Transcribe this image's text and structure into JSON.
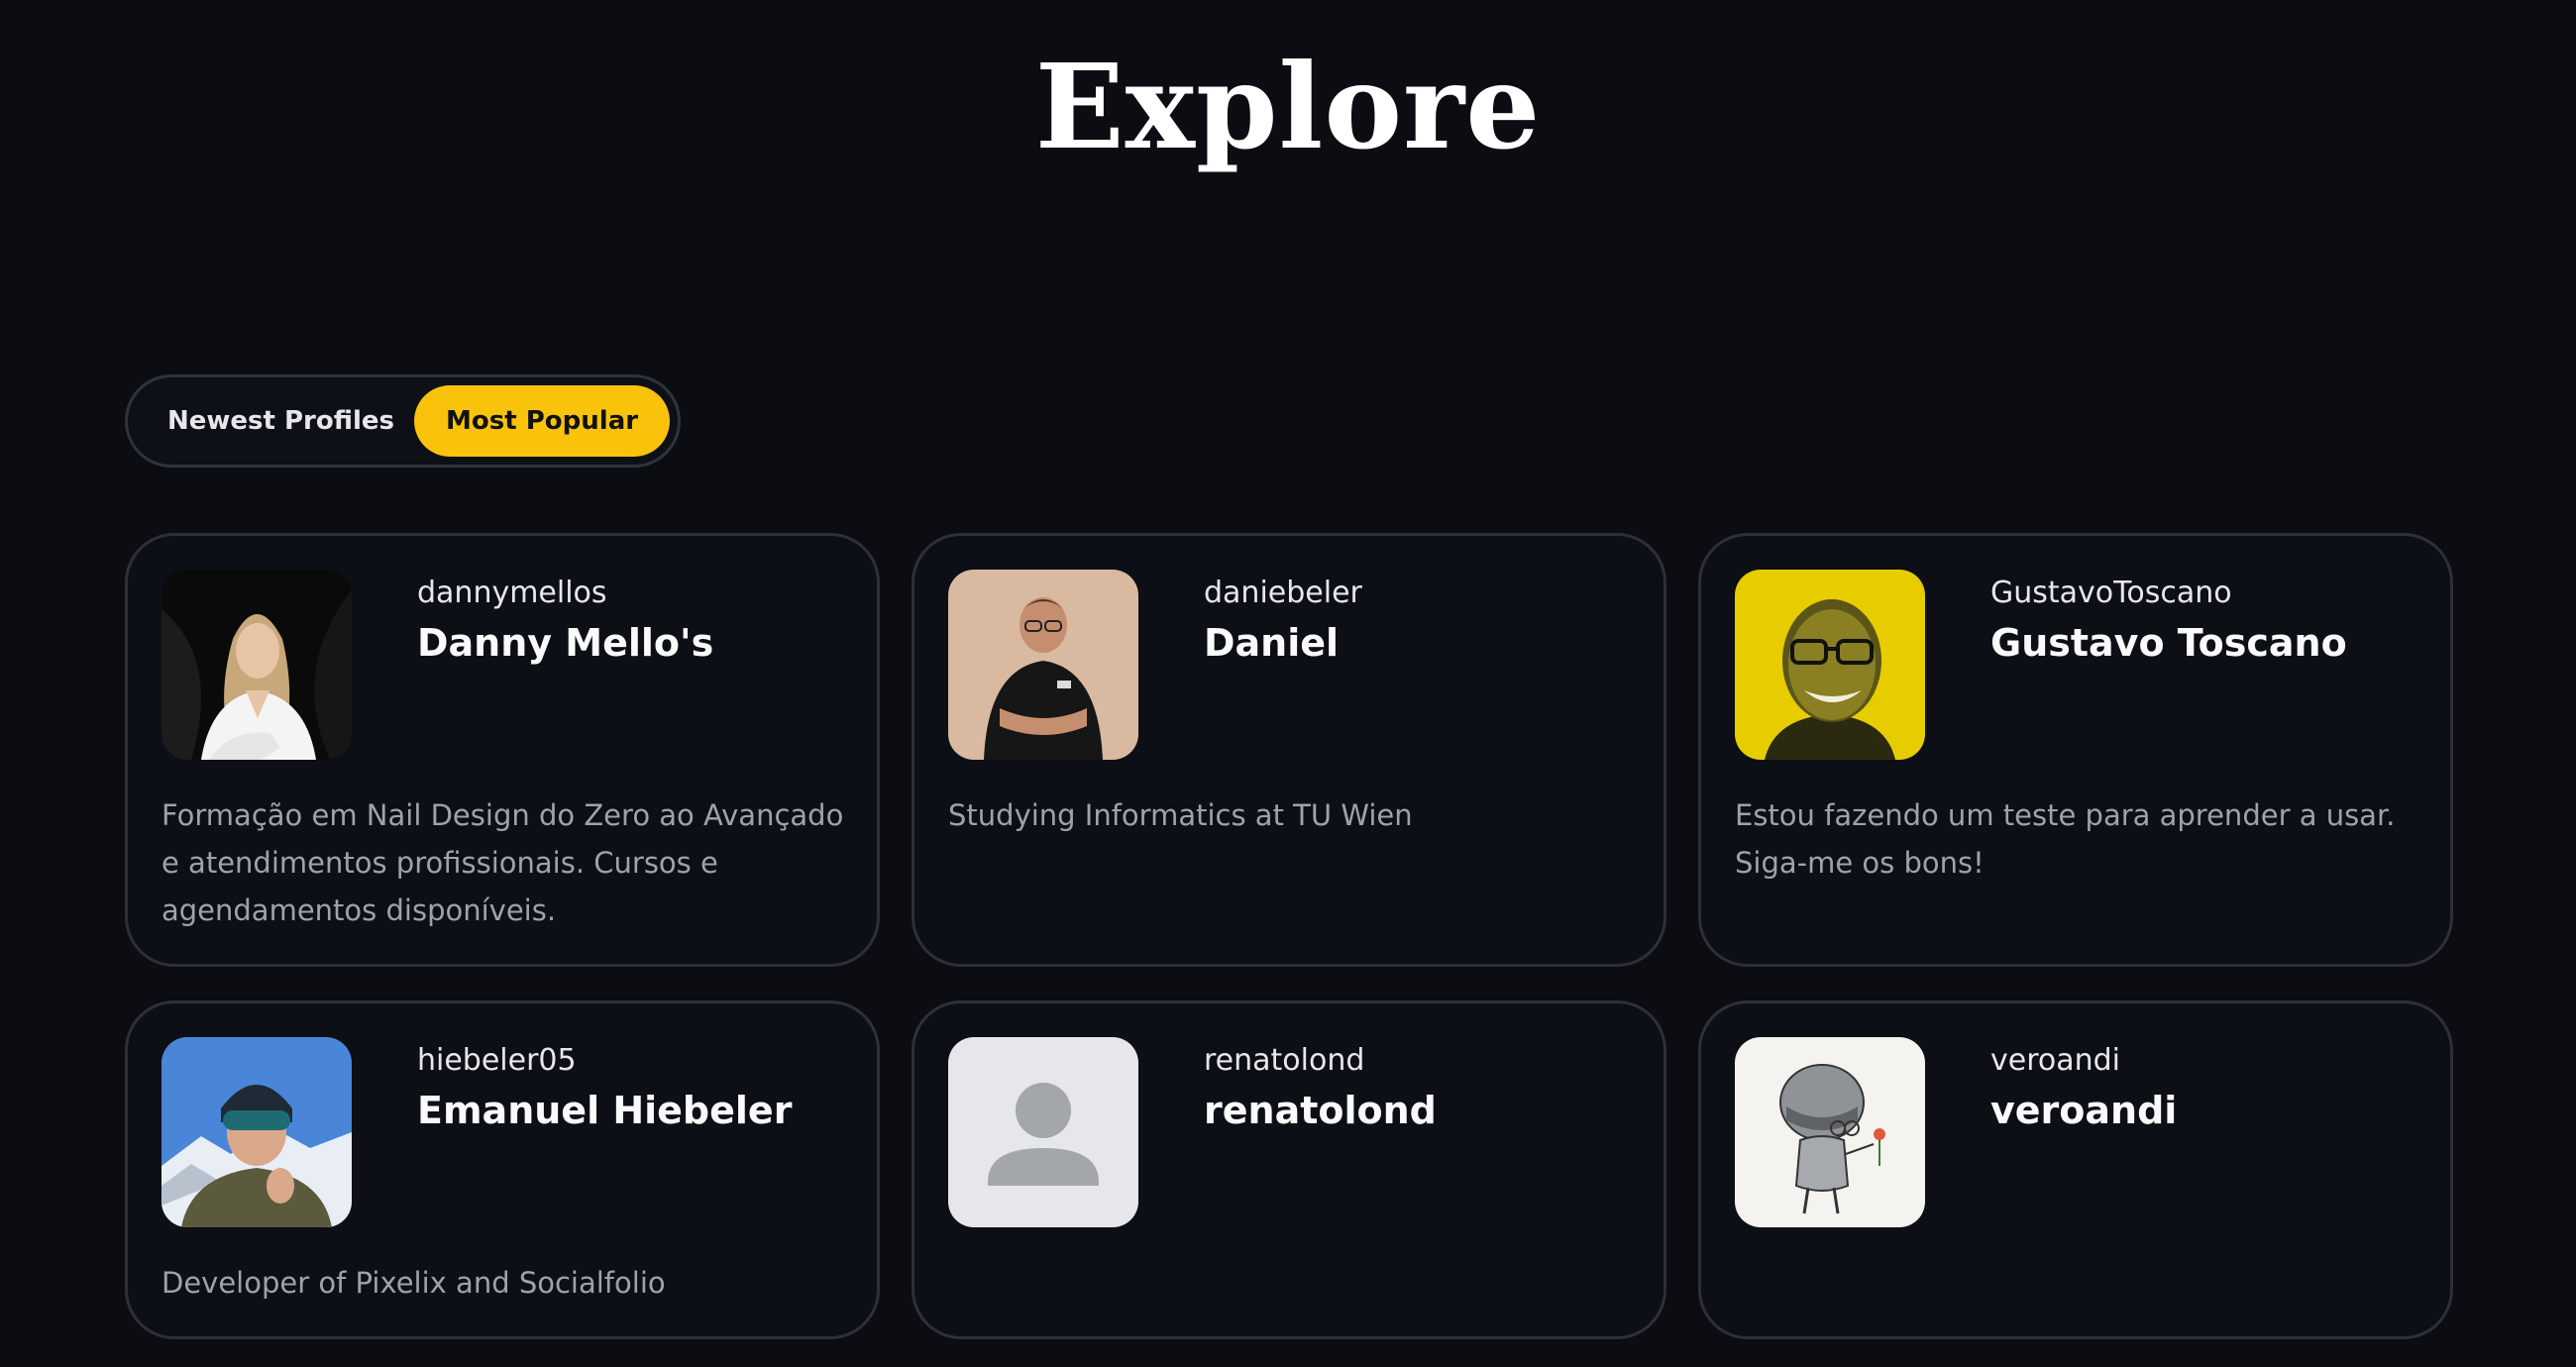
{
  "page": {
    "title": "Explore"
  },
  "tabs": [
    {
      "label": "Newest Profiles",
      "active": false
    },
    {
      "label": "Most Popular",
      "active": true
    }
  ],
  "colors": {
    "background": "#0b0d12",
    "accent": "#f9c30c",
    "card_border": "#2d3038",
    "bio_text": "#9ca3af"
  },
  "profiles": [
    {
      "username": "dannymellos",
      "display_name": "Danny Mello's",
      "bio": "Formação em Nail Design do Zero ao Avançado e atendimentos profissionais. Cursos e agendamentos disponíveis.",
      "avatar": "woman-photo-avatar"
    },
    {
      "username": "daniebeler",
      "display_name": "Daniel",
      "bio": "Studying Informatics at TU Wien",
      "avatar": "man-photo-avatar"
    },
    {
      "username": "GustavoToscano",
      "display_name": "Gustavo Toscano",
      "bio": "Estou fazendo um teste para aprender a usar. Siga-me os bons!",
      "avatar": "yellow-portrait-avatar"
    },
    {
      "username": "hiebeler05",
      "display_name": "Emanuel Hiebeler",
      "bio": "Developer of Pixelix and Socialfolio",
      "avatar": "skier-photo-avatar"
    },
    {
      "username": "renatolond",
      "display_name": "renatolond",
      "bio": "",
      "avatar": "default-user-icon"
    },
    {
      "username": "veroandi",
      "display_name": "veroandi",
      "bio": "",
      "avatar": "robot-drawing-avatar"
    }
  ]
}
